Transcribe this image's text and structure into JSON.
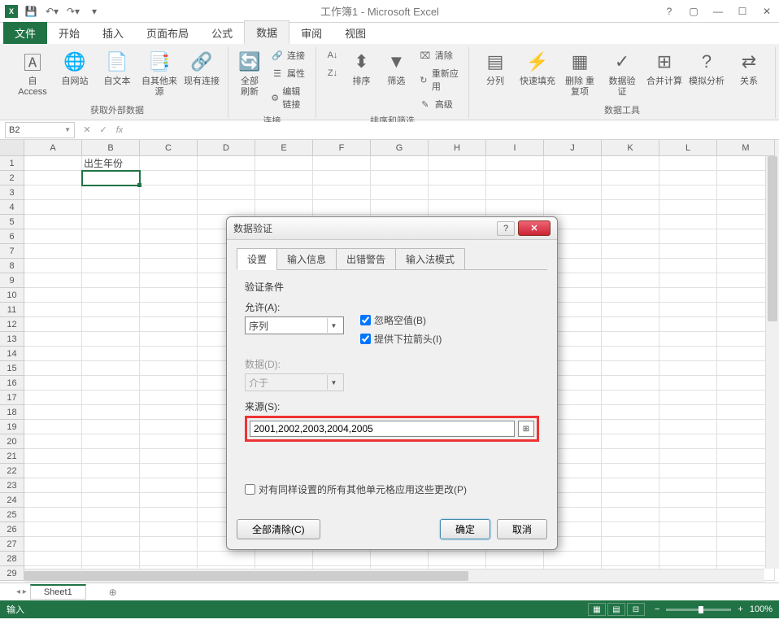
{
  "title": "工作簿1 - Microsoft Excel",
  "qat": {
    "save": "保存",
    "undo": "撤销",
    "redo": "恢复"
  },
  "tabs": {
    "file": "文件",
    "home": "开始",
    "insert": "插入",
    "pageLayout": "页面布局",
    "formulas": "公式",
    "data": "数据",
    "review": "审阅",
    "view": "视图"
  },
  "ribbon": {
    "group1": {
      "label": "获取外部数据",
      "access": "自 Access",
      "web": "自网站",
      "text": "自文本",
      "other": "自其他来源",
      "existing": "现有连接"
    },
    "group2": {
      "label": "连接",
      "refresh": "全部刷新",
      "connections": "连接",
      "properties": "属性",
      "editLinks": "编辑链接"
    },
    "group3": {
      "label": "排序和筛选",
      "sortAZ": "A→Z",
      "sortZA": "Z→A",
      "sort": "排序",
      "filter": "筛选",
      "clear": "清除",
      "reapply": "重新应用",
      "advanced": "高级"
    },
    "group4": {
      "label": "数据工具",
      "textToCol": "分列",
      "flashFill": "快速填充",
      "removeDup": "删除\n重复项",
      "validation": "数据验\n证",
      "consolidate": "合并计算",
      "whatIf": "模拟分析",
      "relations": "关系"
    }
  },
  "namebox": "B2",
  "columns": [
    "A",
    "B",
    "C",
    "D",
    "E",
    "F",
    "G",
    "H",
    "I",
    "J",
    "K",
    "L",
    "M"
  ],
  "rowCount": 29,
  "cellB1": "出生年份",
  "sheet": {
    "name": "Sheet1",
    "add": "+"
  },
  "status": {
    "mode": "输入",
    "zoom": "100%"
  },
  "dialog": {
    "title": "数据验证",
    "tabs": {
      "settings": "设置",
      "input": "输入信息",
      "error": "出错警告",
      "ime": "输入法模式"
    },
    "section": "验证条件",
    "allowLabel": "允许(A):",
    "allowValue": "序列",
    "ignoreBlank": "忽略空值(B)",
    "dropdown": "提供下拉箭头(I)",
    "dataLabel": "数据(D):",
    "dataValue": "介于",
    "sourceLabel": "来源(S):",
    "sourceValue": "2001,2002,2003,2004,2005",
    "applyAll": "对有同样设置的所有其他单元格应用这些更改(P)",
    "clearAll": "全部清除(C)",
    "ok": "确定",
    "cancel": "取消"
  }
}
